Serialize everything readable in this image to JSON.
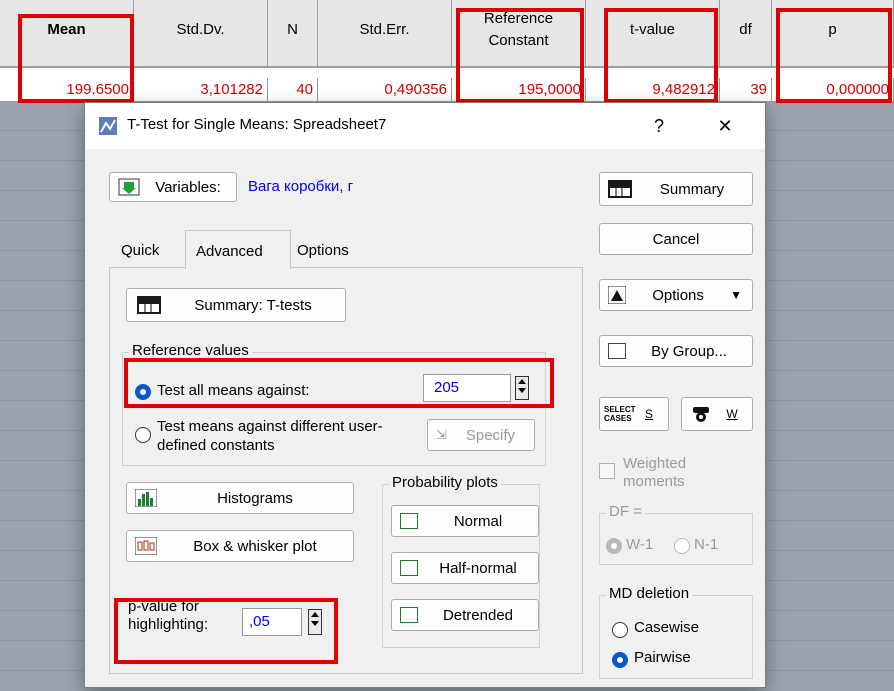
{
  "spreadsheet": {
    "headers": [
      "Mean",
      "Std.Dv.",
      "N",
      "Std.Err.",
      "Reference\nConstant",
      "t-value",
      "df",
      "p"
    ],
    "values": [
      "199.6500",
      "3,101282",
      "40",
      "0,490356",
      "195,0000",
      "9,482912",
      "39",
      "0,000000"
    ]
  },
  "dialog": {
    "title": "T-Test for Single Means: Spreadsheet7",
    "help_label": "?",
    "close_label": "✕",
    "variables_button": "Variables:",
    "variables_value": "Вага коробки, г",
    "tabs": [
      "Quick",
      "Advanced",
      "Options"
    ],
    "summary_ttests_button": "Summary: T-tests",
    "reference_group_title": "Reference values",
    "radio_test_all": "Test all means against:",
    "test_all_value": "205",
    "radio_test_different": "Test means against different user-defined constants",
    "specify_button": "Specify",
    "histograms_button": "Histograms",
    "boxplot_button": "Box & whisker plot",
    "probability_title": "Probability plots",
    "normal_button": "Normal",
    "halfnormal_button": "Half-normal",
    "detrended_button": "Detrended",
    "pvalue_label": "p-value for highlighting:",
    "pvalue_value": ",05",
    "right": {
      "summary": "Summary",
      "cancel": "Cancel",
      "options": "Options",
      "bygroup": "By Group...",
      "select_cases": "SELECT CASES",
      "select_s": "S",
      "weight_w": "W",
      "weighted_moments": "Weighted moments",
      "df_title": "DF =",
      "df_w1": "W-1",
      "df_n1": "N-1",
      "md_title": "MD deletion",
      "casewise": "Casewise",
      "pairwise": "Pairwise"
    }
  },
  "colors": {
    "highlight_red": "#e00000",
    "value_red": "#d10000",
    "link_blue": "#0000ee",
    "radio_blue": "#0a57c8"
  }
}
